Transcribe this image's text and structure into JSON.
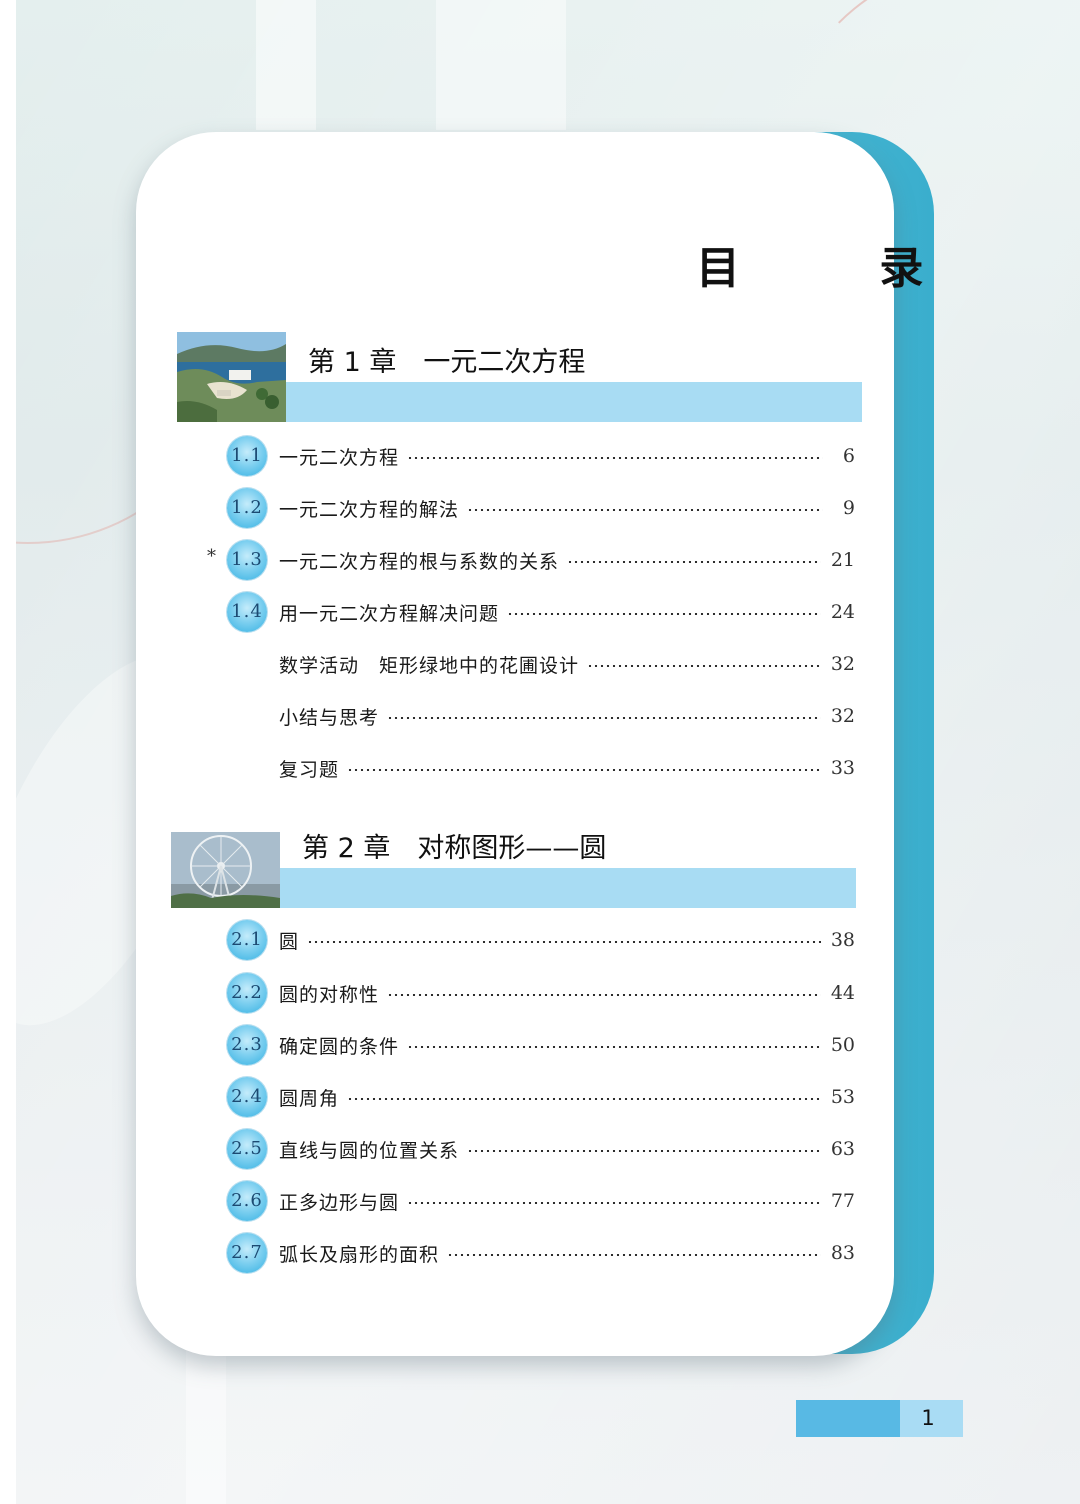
{
  "toc_title": "目 录",
  "chapters": [
    {
      "title": "第 1 章　一元二次方程",
      "entries": [
        {
          "num": "1.1",
          "label": "一元二次方程",
          "page": "6",
          "starred": false
        },
        {
          "num": "1.2",
          "label": "一元二次方程的解法",
          "page": "9",
          "starred": false
        },
        {
          "num": "1.3",
          "label": "一元二次方程的根与系数的关系",
          "page": "21",
          "starred": true
        },
        {
          "num": "1.4",
          "label": "用一元二次方程解决问题",
          "page": "24",
          "starred": false
        },
        {
          "num": "",
          "label": "数学活动　矩形绿地中的花圃设计",
          "page": "32",
          "starred": false
        },
        {
          "num": "",
          "label": "小结与思考",
          "page": "32",
          "starred": false
        },
        {
          "num": "",
          "label": "复习题",
          "page": "33",
          "starred": false
        }
      ]
    },
    {
      "title": "第 2 章　对称图形——圆",
      "entries": [
        {
          "num": "2.1",
          "label": "圆",
          "page": "38",
          "starred": false
        },
        {
          "num": "2.2",
          "label": "圆的对称性",
          "page": "44",
          "starred": false
        },
        {
          "num": "2.3",
          "label": "确定圆的条件",
          "page": "50",
          "starred": false
        },
        {
          "num": "2.4",
          "label": "圆周角",
          "page": "53",
          "starred": false
        },
        {
          "num": "2.5",
          "label": "直线与圆的位置关系",
          "page": "63",
          "starred": false
        },
        {
          "num": "2.6",
          "label": "正多边形与圆",
          "page": "77",
          "starred": false
        },
        {
          "num": "2.7",
          "label": "弧长及扇形的面积",
          "page": "83",
          "starred": false
        }
      ]
    }
  ],
  "star_mark": "*",
  "page_number": "1",
  "colors": {
    "bar": "#a8dcf3",
    "badge": "#33b0e2",
    "tab_dark": "#58b9e4",
    "tab_light": "#a9dcf4"
  }
}
